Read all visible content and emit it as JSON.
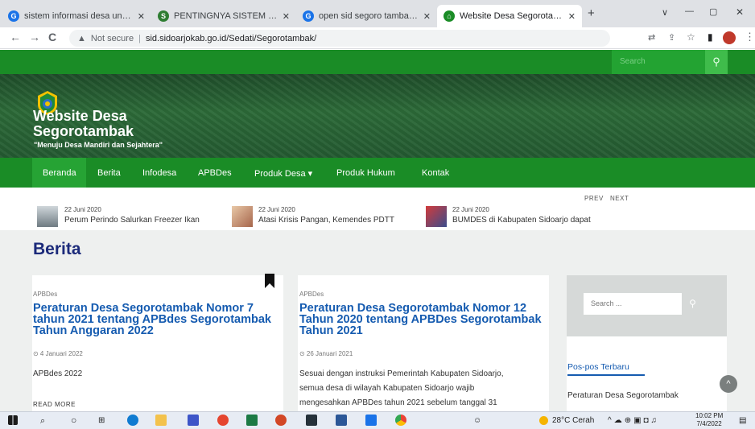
{
  "browser": {
    "tabs": [
      {
        "title": "sistem informasi desa untuk mer",
        "favicon": "G",
        "color": "#1a73e8",
        "active": false
      },
      {
        "title": "PENTINGNYA SISTEM INFORMA",
        "favicon": "S",
        "color": "#2e7d32",
        "active": false
      },
      {
        "title": "open sid segoro tambak - Googl",
        "favicon": "G",
        "color": "#1a73e8",
        "active": false
      },
      {
        "title": "Website Desa Segorotambak",
        "favicon": "⌂",
        "color": "#1a8c26",
        "active": true
      }
    ],
    "new_tab": "+",
    "window_controls": [
      "∨",
      "—",
      "▢",
      "✕"
    ],
    "nav": {
      "back": "←",
      "forward": "→",
      "reload": "C"
    },
    "address": {
      "security": "Not secure",
      "url": "sid.sidoarjokab.go.id/Sedati/Segorotambak/"
    },
    "toolbar_icons": [
      "⇄",
      "⇪",
      "☆",
      "▮"
    ]
  },
  "site": {
    "top_search_placeholder": "Search",
    "top_search_icon": "search-icon",
    "title_line1": "Website Desa",
    "title_line2": "Segorotambak",
    "tagline": "\"Menuju Desa Mandiri dan Sejahtera\"",
    "menu": [
      "Beranda",
      "Berita",
      "Infodesa",
      "APBDes",
      "Produk Desa ▾",
      "Produk Hukum",
      "Kontak"
    ],
    "ticker": {
      "prev": "PREV",
      "next": "NEXT",
      "items": [
        {
          "date": "22 Juni 2020",
          "title": "Perum Perindo Salurkan Freezer Ikan"
        },
        {
          "date": "22 Juni 2020",
          "title": "Atasi Krisis Pangan, Kemendes PDTT"
        },
        {
          "date": "22 Juni 2020",
          "title": "BUMDES di Kabupaten Sidoarjo dapat"
        }
      ]
    },
    "page_title": "Berita",
    "posts": [
      {
        "category": "APBDes",
        "title": "Peraturan Desa Segorotambak Nomor 7 tahun 2021 tentang APBdes Segorotambak Tahun Anggaran 2022",
        "date": "⊙ 4 Januari 2022",
        "excerpt": "APBdes 2022",
        "read_more": "READ MORE"
      },
      {
        "category": "APBDes",
        "title": "Peraturan Desa Segorotambak Nomor 12 Tahun 2020 tentang APBDes Segorotambak Tahun 2021",
        "date": "⊙ 26 Januari 2021",
        "excerpt_lines": [
          "Sesuai dengan instruksi Pemerintah Kabupaten Sidoarjo,",
          "semua desa di wilayah Kabupaten Sidoarjo wajib",
          "mengesahkan APBDes tahun 2021 sebelum tanggal 31"
        ]
      }
    ],
    "sidebar": {
      "search_placeholder": "Search ...",
      "recent_title": "Pos-pos Terbaru",
      "recent": [
        "Peraturan Desa Segorotambak"
      ]
    },
    "back_to_top": "^"
  },
  "taskbar": {
    "weather": "28°C Cerah",
    "time": "10:02 PM",
    "date": "7/4/2022"
  }
}
